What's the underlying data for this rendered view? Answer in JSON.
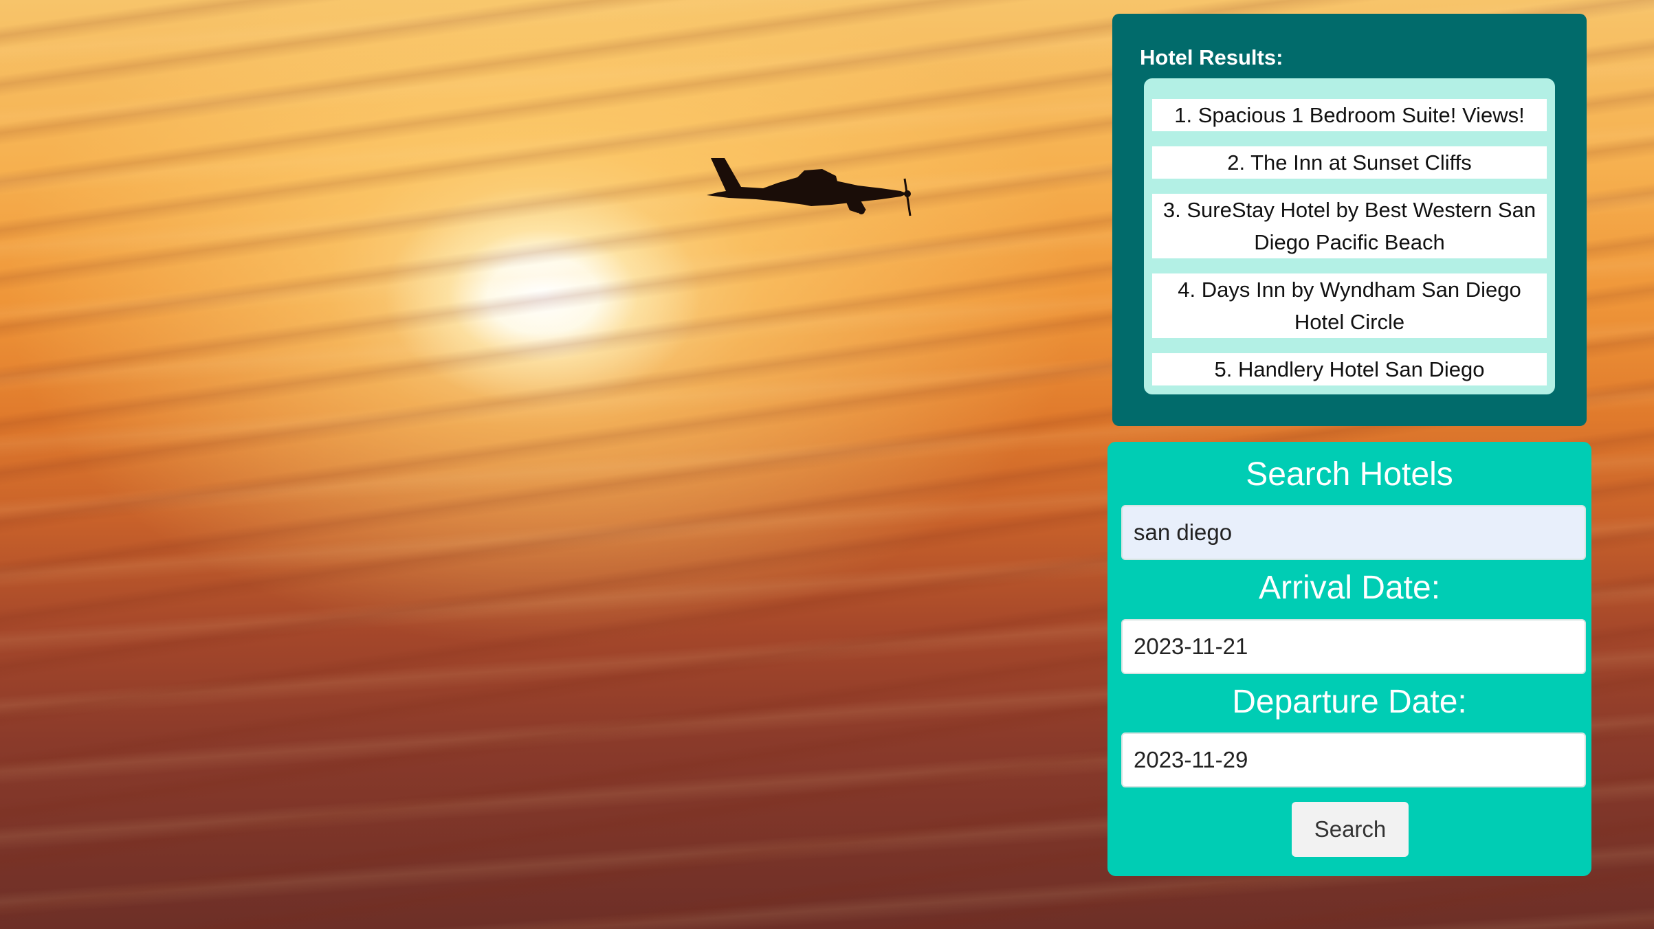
{
  "results": {
    "title": "Hotel Results:",
    "items": [
      "1. Spacious 1 Bedroom Suite! Views!",
      "2. The Inn at Sunset Cliffs",
      "3. SureStay Hotel by Best Western San Diego Pacific Beach",
      "4. Days Inn by Wyndham San Diego Hotel Circle",
      "5. Handlery Hotel San Diego"
    ]
  },
  "search": {
    "heading": "Search Hotels",
    "location_value": "san diego",
    "arrival_label": "Arrival Date:",
    "arrival_value": "2023-11-21",
    "departure_label": "Departure Date:",
    "departure_value": "2023-11-29",
    "button_label": "Search"
  },
  "colors": {
    "results_panel": "#016b6b",
    "results_list": "#b3f0e5",
    "search_panel": "#00cdb4"
  }
}
